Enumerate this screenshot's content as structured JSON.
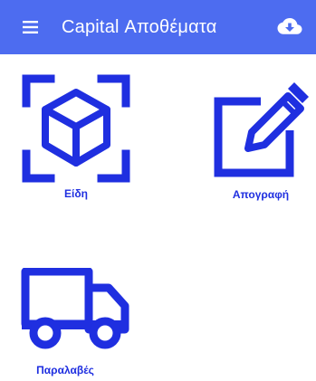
{
  "app": {
    "title": "Capital Αποθέματα",
    "menu_icon": "hamburger-menu-icon",
    "cloud_icon": "cloud-download-icon"
  },
  "colors": {
    "appbar": "#4d6cf0",
    "accent": "#1f2fe0",
    "background": "#ffffff"
  },
  "tiles": [
    {
      "id": "items",
      "label": "Είδη",
      "icon": "package-scan-icon"
    },
    {
      "id": "inventory",
      "label": "Απογραφή",
      "icon": "edit-square-icon"
    },
    {
      "id": "receipts",
      "label": "Παραλαβές",
      "icon": "truck-icon"
    }
  ]
}
